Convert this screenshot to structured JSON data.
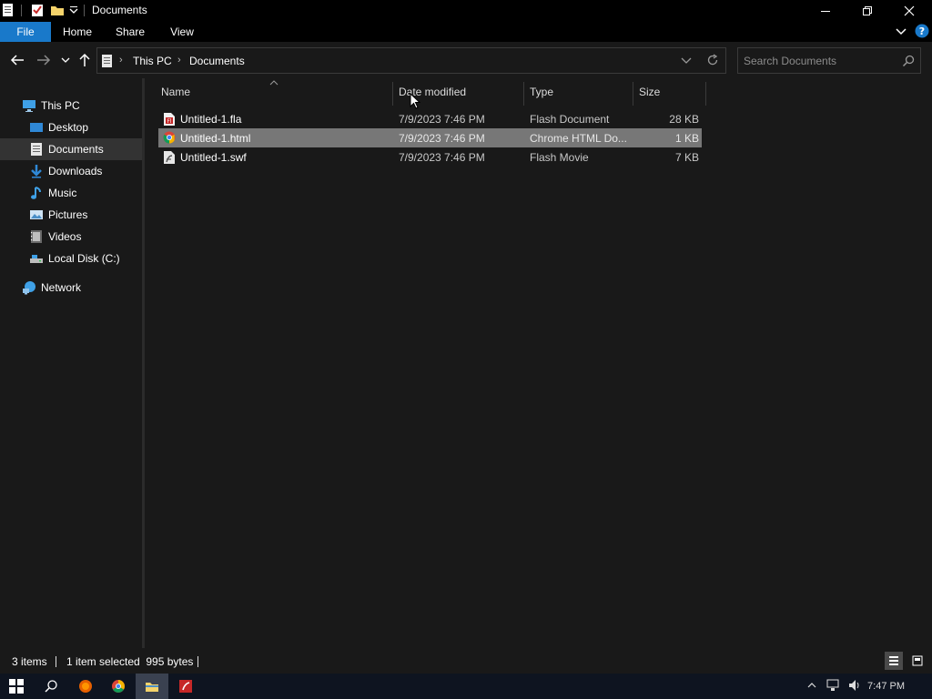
{
  "window": {
    "title": "Documents",
    "accent": "#1979ca"
  },
  "ribbon": {
    "tabs": [
      "File",
      "Home",
      "Share",
      "View"
    ]
  },
  "address": {
    "crumbs": [
      "This PC",
      "Documents"
    ]
  },
  "search": {
    "placeholder": "Search Documents"
  },
  "navpane": {
    "this_pc": "This PC",
    "items": [
      {
        "label": "Desktop",
        "icon": "desktop-icon"
      },
      {
        "label": "Documents",
        "icon": "documents-icon",
        "selected": true
      },
      {
        "label": "Downloads",
        "icon": "downloads-icon"
      },
      {
        "label": "Music",
        "icon": "music-icon"
      },
      {
        "label": "Pictures",
        "icon": "pictures-icon"
      },
      {
        "label": "Videos",
        "icon": "videos-icon"
      },
      {
        "label": "Local Disk (C:)",
        "icon": "drive-icon"
      }
    ],
    "network": "Network"
  },
  "columns": {
    "name": "Name",
    "date": "Date modified",
    "type": "Type",
    "size": "Size",
    "sort_icon": "sort-ascending-icon"
  },
  "files": [
    {
      "name": "Untitled-1.fla",
      "date": "7/9/2023 7:46 PM",
      "type": "Flash Document",
      "size": "28 KB",
      "icon": "flash-document-icon",
      "selected": false
    },
    {
      "name": "Untitled-1.html",
      "date": "7/9/2023 7:46 PM",
      "type": "Chrome HTML Do...",
      "size": "1 KB",
      "icon": "chrome-icon",
      "selected": true
    },
    {
      "name": "Untitled-1.swf",
      "date": "7/9/2023 7:46 PM",
      "type": "Flash Movie",
      "size": "7 KB",
      "icon": "flash-movie-icon",
      "selected": false
    }
  ],
  "status": {
    "count": "3 items",
    "selection": "1 item selected  995 bytes"
  },
  "taskbar": {
    "clock": "7:47 PM"
  }
}
